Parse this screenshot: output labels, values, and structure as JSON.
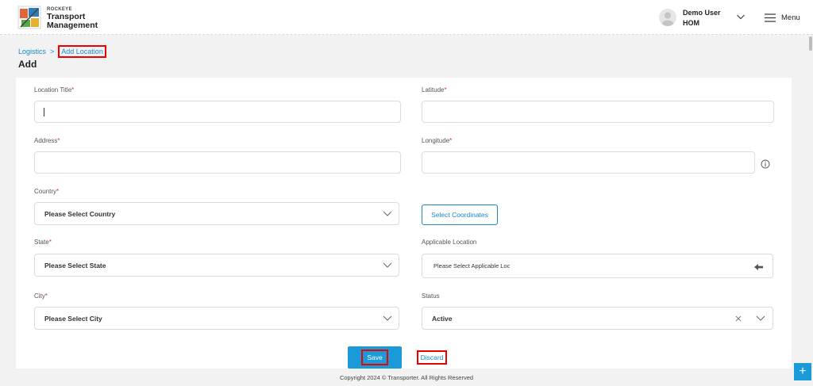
{
  "header": {
    "brand_small": "ROCKEYE",
    "brand_line1": "Transport",
    "brand_line2": "Management",
    "user_name": "Demo User",
    "user_org": "HOM",
    "menu_label": "Menu"
  },
  "breadcrumb": {
    "parent": "Logistics",
    "separator": ">",
    "current": "Add Location"
  },
  "page_title": "Add",
  "form": {
    "location_title": {
      "label": "Location Title",
      "required": "*",
      "value": ""
    },
    "latitude": {
      "label": "Latitude",
      "required": "*",
      "value": ""
    },
    "address": {
      "label": "Address",
      "required": "*",
      "value": ""
    },
    "longitude": {
      "label": "Longitude",
      "required": "*",
      "value": ""
    },
    "country": {
      "label": "Country",
      "required": "*",
      "value": "Please Select Country"
    },
    "select_coordinates": "Select Coordinates",
    "state": {
      "label": "State",
      "required": "*",
      "value": "Please Select State"
    },
    "applicable_location": {
      "label": "Applicable Location",
      "value": "Please Select Applicable Loc"
    },
    "city": {
      "label": "City",
      "required": "*",
      "value": "Please Select City"
    },
    "status": {
      "label": "Status",
      "value": "Active"
    }
  },
  "actions": {
    "save": "Save",
    "discard": "Discard"
  },
  "footer": "Copyright 2024 © Transporter. All Rights Reserved",
  "fab_label": "+",
  "colors": {
    "accent": "#1a9ad6",
    "link": "#1a8bc9",
    "required": "#e03030",
    "highlight": "#e00000"
  }
}
